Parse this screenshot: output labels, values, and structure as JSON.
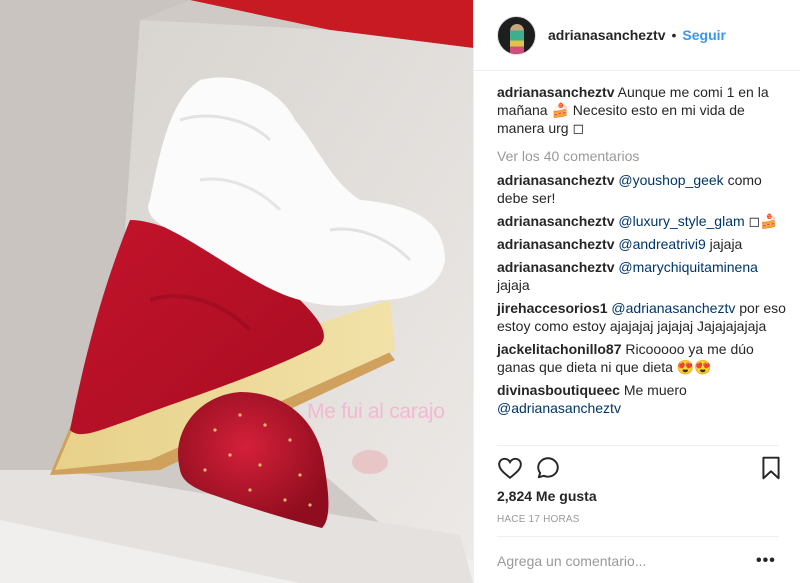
{
  "photo": {
    "overlay_text": "Me fui al carajo",
    "subject": "cheesecake-slice-photo"
  },
  "header": {
    "username": "adrianasancheztv",
    "separator": "•",
    "follow_label": "Seguir"
  },
  "caption": {
    "username": "adrianasancheztv",
    "text": "Aunque me comi 1 en la mañana 🍰 Necesito esto en mi vida de manera urg ◻"
  },
  "view_all": "Ver los 40 comentarios",
  "comments": [
    {
      "username": "adrianasancheztv",
      "mention": "@youshop_geek",
      "text": " como debe ser!"
    },
    {
      "username": "adrianasancheztv",
      "mention": "@luxury_style_glam",
      "text": " ◻🍰"
    },
    {
      "username": "adrianasancheztv",
      "mention": "@andreatrivi9",
      "text": " jajaja"
    },
    {
      "username": "adrianasancheztv",
      "mention": "@marychiquitaminena",
      "text": " jajaja"
    },
    {
      "username": "jirehaccesorios1",
      "mention": "@adrianasancheztv",
      "text": " por eso estoy como estoy ajajajaj jajajaj Jajajajajaja"
    },
    {
      "username": "jackelitachonillo87",
      "mention": "",
      "text": "Ricooooo ya me dúo ganas que dieta ni que dieta 😍😍"
    },
    {
      "username": "divinasboutiqueec",
      "mention": "",
      "text": "Me muero ",
      "mention_after": "@adrianasancheztv"
    }
  ],
  "actions": {
    "like_icon": "heart-icon",
    "comment_icon": "comment-icon",
    "save_icon": "bookmark-icon"
  },
  "likes": "2,824 Me gusta",
  "timestamp": "Hace 17 horas",
  "add_comment_placeholder": "Agrega un comentario...",
  "more_label": "•••",
  "colors": {
    "link_blue": "#3897f0",
    "mention_blue": "#003569",
    "muted_gray": "#999999",
    "text_dark": "#262626"
  }
}
